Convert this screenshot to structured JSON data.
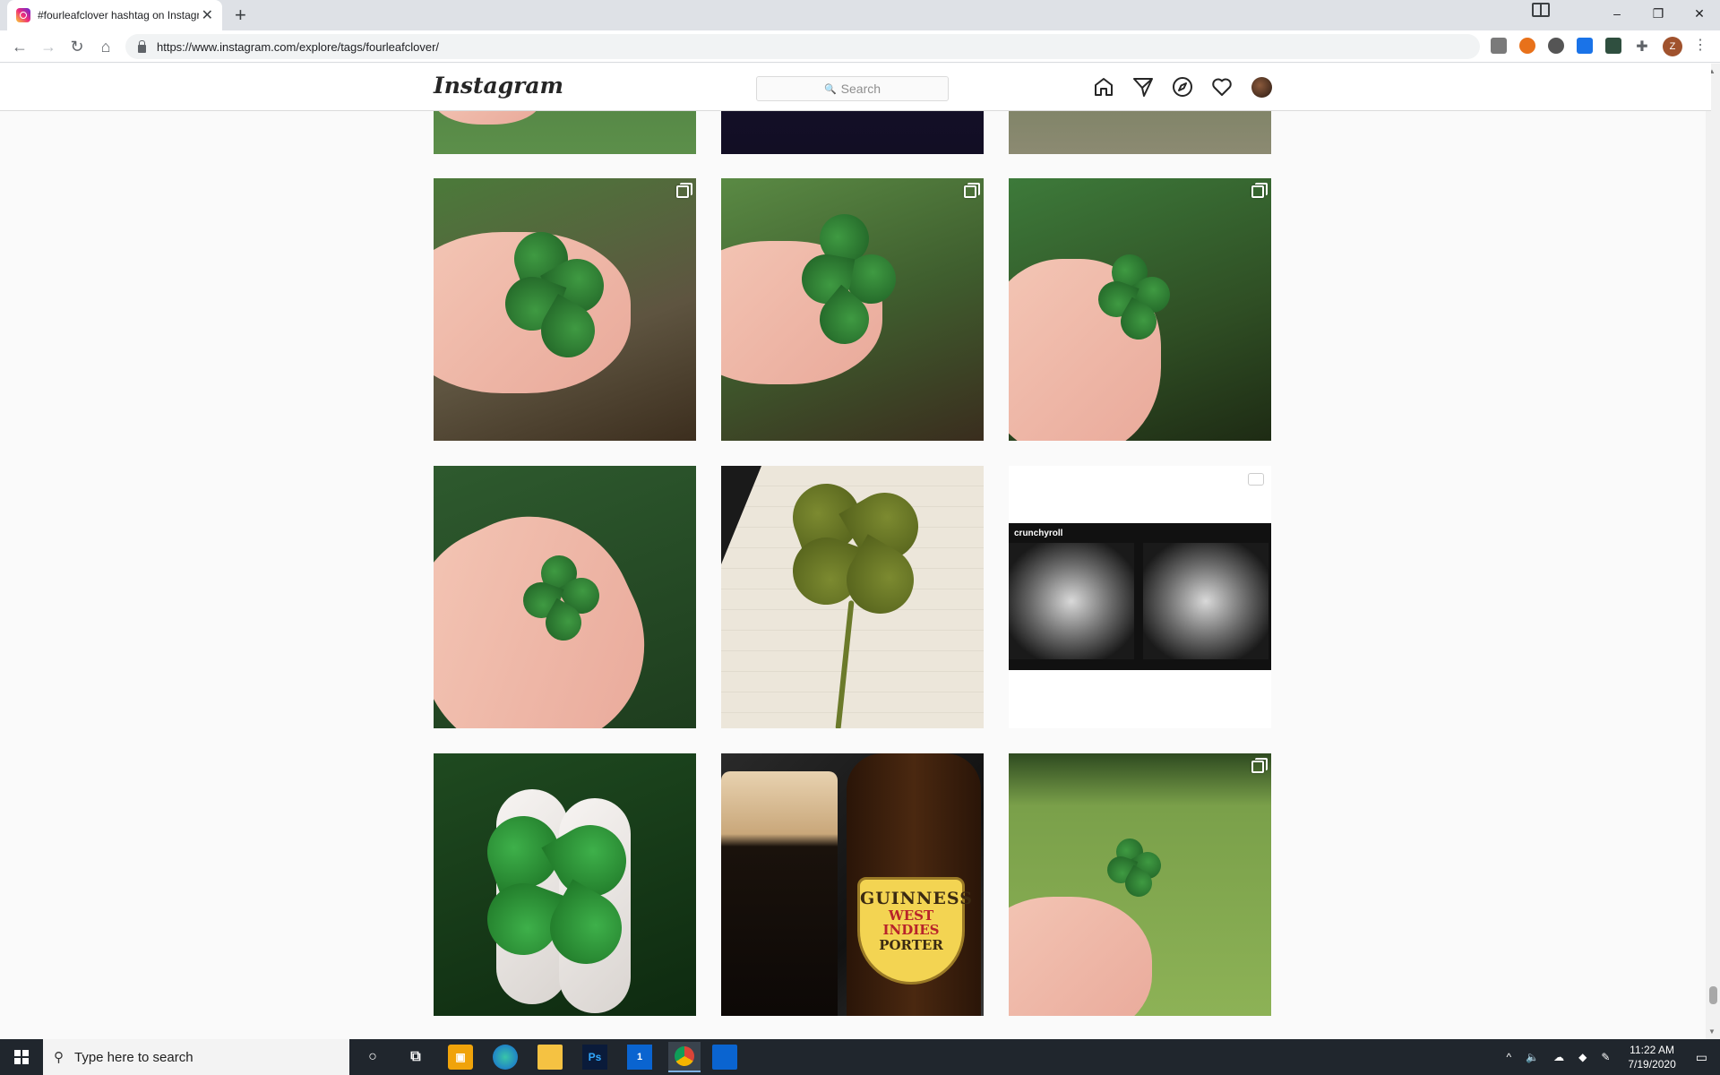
{
  "browser": {
    "tab_title": "#fourleafclover hashtag on Instagram",
    "new_tab_label": "+",
    "url": "https://www.instagram.com/explore/tags/fourleafclover/",
    "profile_initial": "Z",
    "window_controls": {
      "minimize": "–",
      "restore": "❐",
      "close": "✕"
    }
  },
  "instagram": {
    "logo": "Instagram",
    "search_placeholder": "Search",
    "nav_icons": [
      "home-icon",
      "direct-icon",
      "explore-icon",
      "activity-icon",
      "profile-avatar"
    ]
  },
  "grid": {
    "posts": [
      {
        "icon": "multiple-posts-icon"
      },
      {
        "icon": "multiple-posts-icon"
      },
      {
        "icon": "multiple-posts-icon"
      },
      {
        "icon": "none"
      },
      {
        "icon": "none"
      },
      {
        "icon": "video-icon",
        "overlay_text": "crunchyroll"
      },
      {
        "icon": "none"
      },
      {
        "icon": "none"
      },
      {
        "icon": "multiple-posts-icon"
      }
    ],
    "beer_label": {
      "title": "GUINNESS",
      "line1": "WEST INDIES",
      "line2": "PORTER"
    }
  },
  "taskbar": {
    "search_placeholder": "Type here to search",
    "time": "11:22 AM",
    "date": "7/19/2020",
    "mail_badge": "1"
  }
}
